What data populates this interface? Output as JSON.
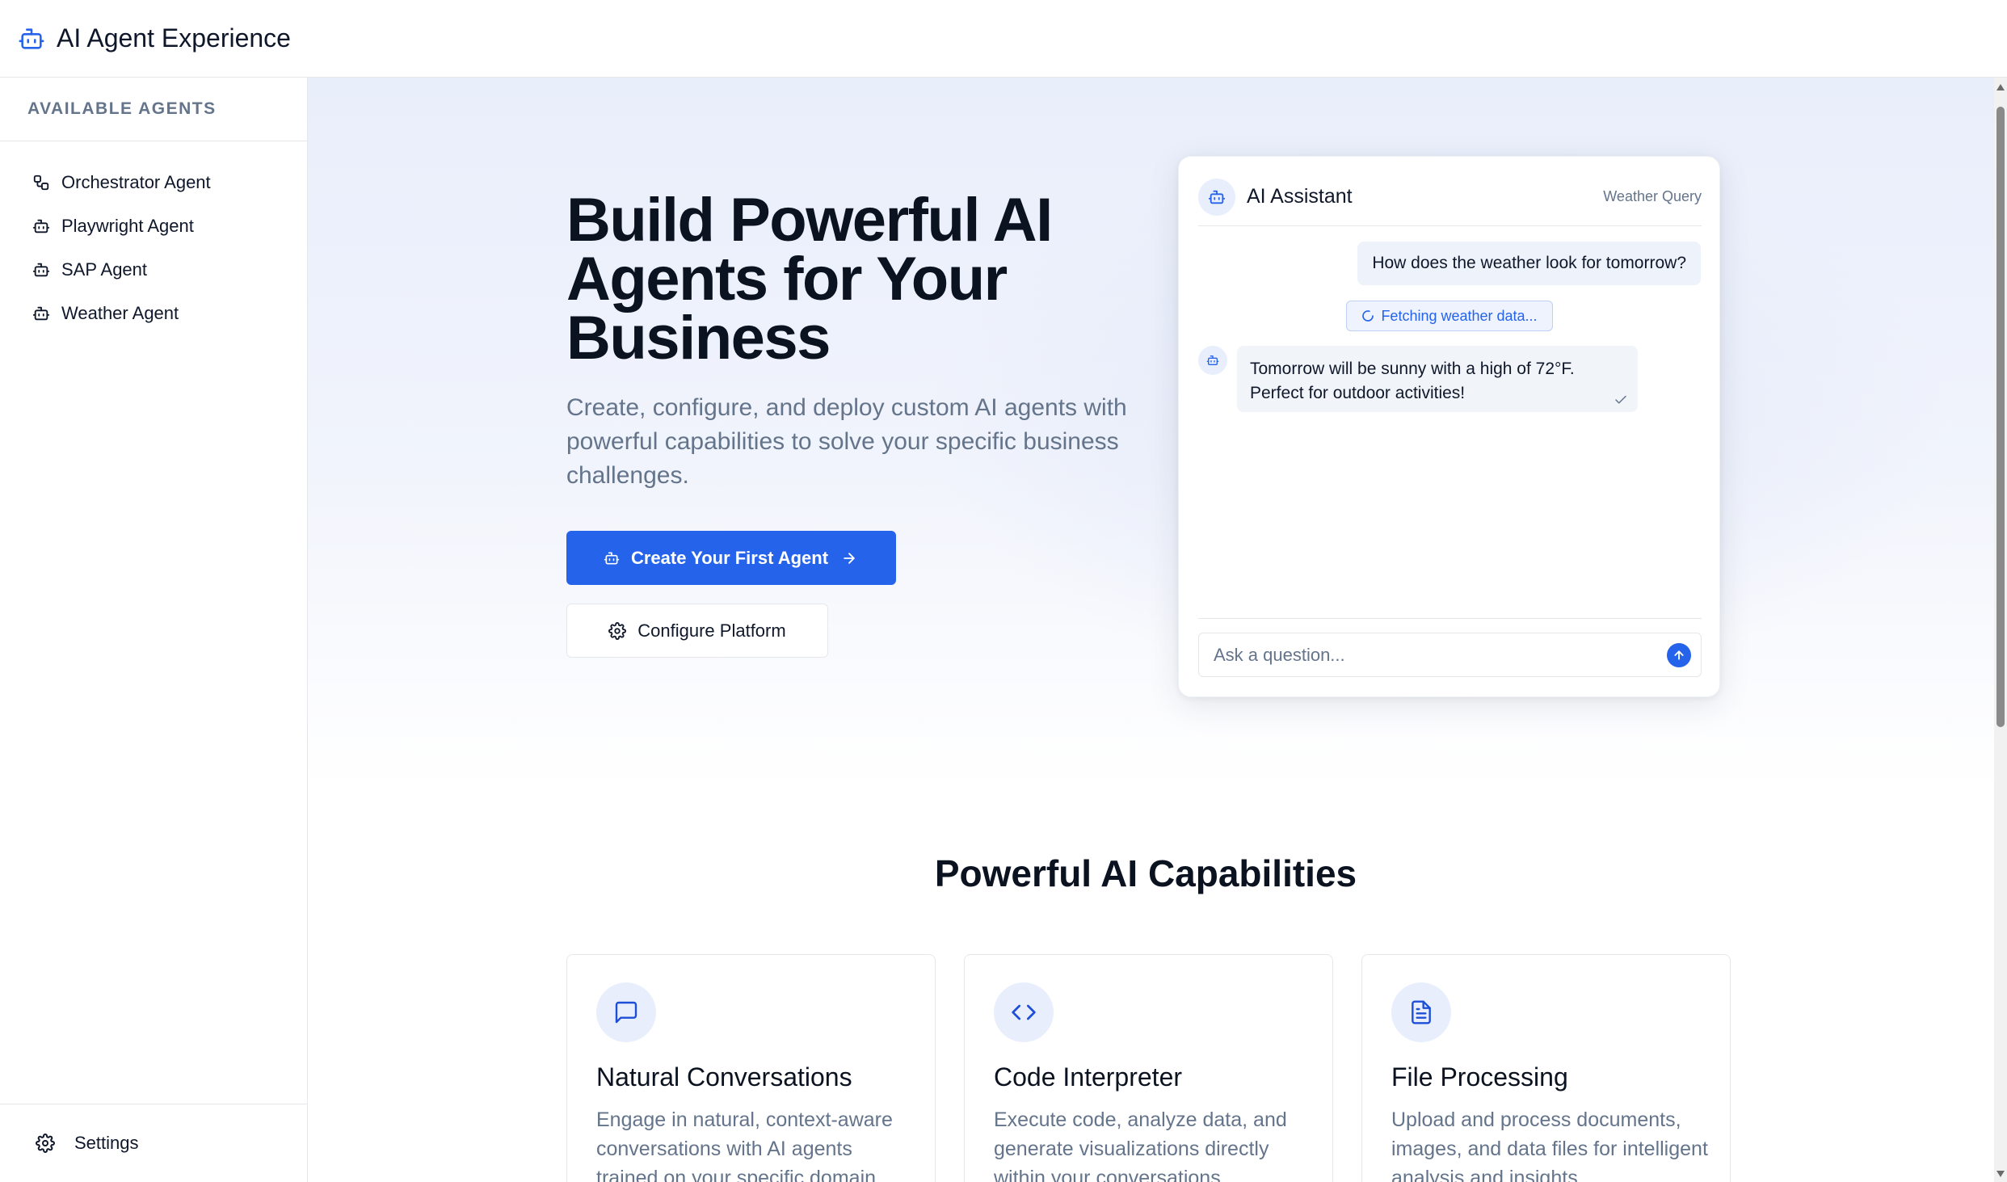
{
  "app": {
    "title": "AI Agent Experience"
  },
  "sidebar": {
    "header": "AVAILABLE AGENTS",
    "items": [
      {
        "label": "Orchestrator Agent",
        "icon": "workflow-icon"
      },
      {
        "label": "Playwright Agent",
        "icon": "bot-icon"
      },
      {
        "label": "SAP Agent",
        "icon": "bot-icon"
      },
      {
        "label": "Weather Agent",
        "icon": "bot-icon"
      }
    ],
    "footer": {
      "label": "Settings",
      "icon": "gear-icon"
    }
  },
  "hero": {
    "title": "Build Powerful AI Agents for Your Business",
    "subtitle": "Create, configure, and deploy custom AI agents with powerful capabilities to solve your specific business challenges.",
    "primary_button": "Create Your First Agent",
    "secondary_button": "Configure Platform"
  },
  "chat": {
    "title": "AI Assistant",
    "tag": "Weather Query",
    "user_message": "How does the weather look for tomorrow?",
    "status": "Fetching weather data...",
    "bot_message": "Tomorrow will be sunny with a high of 72°F. Perfect for outdoor activities!",
    "input_placeholder": "Ask a question..."
  },
  "capabilities": {
    "title": "Powerful AI Capabilities",
    "cards": [
      {
        "name": "Natural Conversations",
        "description": "Engage in natural, context-aware conversations with AI agents trained on your specific domain.",
        "icon": "chat-bubble-icon"
      },
      {
        "name": "Code Interpreter",
        "description": "Execute code, analyze data, and generate visualizations directly within your conversations.",
        "icon": "code-icon"
      },
      {
        "name": "File Processing",
        "description": "Upload and process documents, images, and data files for intelligent analysis and insights.",
        "icon": "document-icon"
      }
    ]
  },
  "colors": {
    "accent": "#2563eb",
    "muted_text": "#64748b",
    "border": "#e5e7eb"
  }
}
